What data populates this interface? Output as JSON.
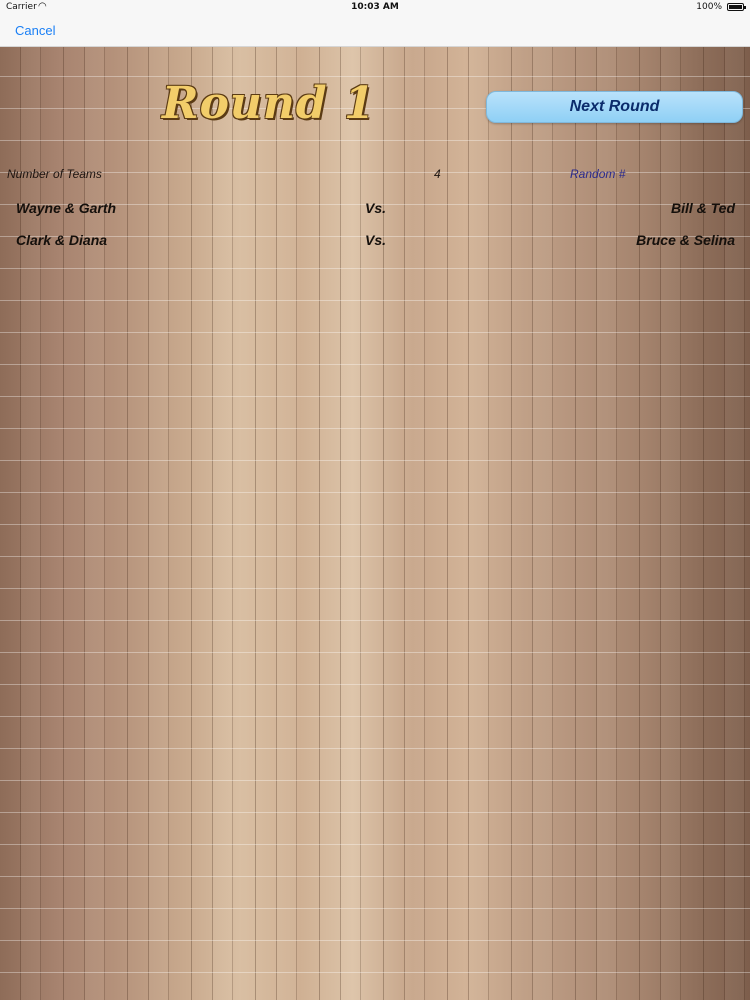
{
  "status_bar": {
    "carrier": "Carrier",
    "time": "10:03 AM",
    "battery": "100%"
  },
  "nav": {
    "cancel_label": "Cancel"
  },
  "header": {
    "title": "Round 1",
    "next_round_label": "Next Round"
  },
  "info": {
    "teams_label": "Number of Teams",
    "teams_count": "4",
    "random_label": "Random #"
  },
  "matches": [
    {
      "team_a": "Wayne & Garth",
      "vs": "Vs.",
      "team_b": "Bill & Ted"
    },
    {
      "team_a": "Clark & Diana",
      "vs": "Vs.",
      "team_b": "Bruce & Selina"
    }
  ],
  "colors": {
    "accent_link": "#1a7ff5",
    "button_bg": "#8fd0f5",
    "button_text": "#0b2b6b",
    "title_gold": "#f2cd6a",
    "random_label": "#2a2a8c"
  }
}
